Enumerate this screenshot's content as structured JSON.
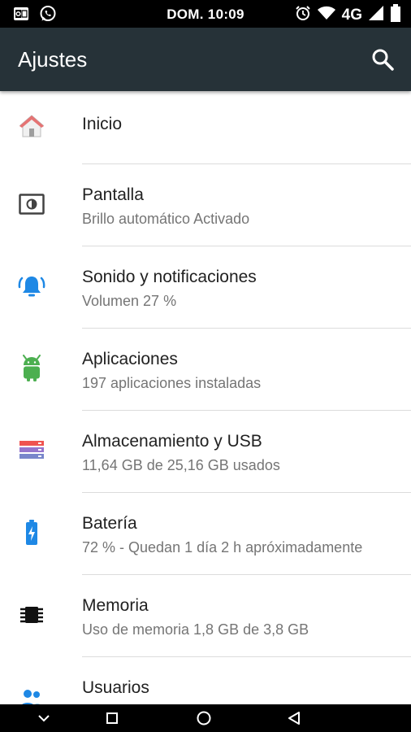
{
  "status_bar": {
    "time": "DOM. 10:09",
    "network": "4G",
    "icons_left": [
      "outlook-icon",
      "whatsapp-icon"
    ],
    "icons_right": [
      "alarm-icon",
      "wifi-icon",
      "signal-icon",
      "battery-icon"
    ]
  },
  "app_bar": {
    "title": "Ajustes",
    "search_icon": "search-icon",
    "background": "#263238"
  },
  "settings": [
    {
      "id": "inicio",
      "title": "Inicio",
      "subtitle": "",
      "icon": "home-icon"
    },
    {
      "id": "pantalla",
      "title": "Pantalla",
      "subtitle": "Brillo automático Activado",
      "icon": "display-icon"
    },
    {
      "id": "sonido",
      "title": "Sonido y notificaciones",
      "subtitle": "Volumen 27 %",
      "icon": "bell-icon"
    },
    {
      "id": "aplicaciones",
      "title": "Aplicaciones",
      "subtitle": "197 aplicaciones instaladas",
      "icon": "android-icon"
    },
    {
      "id": "almacenamiento",
      "title": "Almacenamiento y USB",
      "subtitle": "11,64 GB de 25,16 GB usados",
      "icon": "storage-icon"
    },
    {
      "id": "bateria",
      "title": "Batería",
      "subtitle": "72 % - Quedan 1 día 2 h apróximadamente",
      "icon": "battery-charging-icon"
    },
    {
      "id": "memoria",
      "title": "Memoria",
      "subtitle": "Uso de memoria 1,8 GB de 3,8 GB",
      "icon": "memory-chip-icon"
    },
    {
      "id": "usuarios",
      "title": "Usuarios",
      "subtitle": "",
      "icon": "users-icon"
    }
  ],
  "nav_bar": {
    "buttons": [
      "hide-keyboard-icon",
      "recents-icon",
      "home-circle-icon",
      "back-icon"
    ]
  },
  "colors": {
    "text_primary": "#212121",
    "text_secondary": "#757575",
    "divider": "#dcdcdc",
    "accent_blue": "#1e88e5",
    "android_green": "#4caf50",
    "home_red": "#e57373"
  }
}
